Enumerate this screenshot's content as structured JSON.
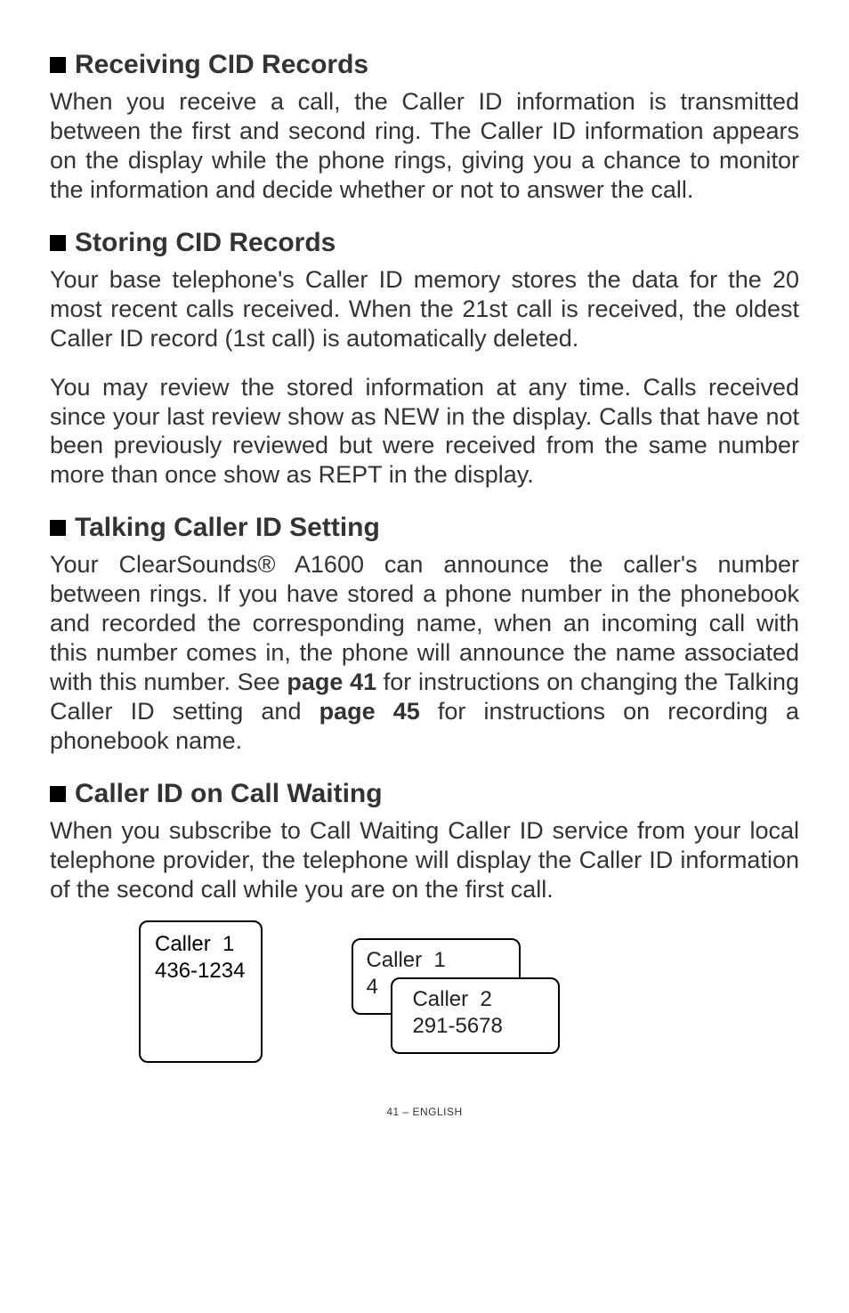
{
  "sections": [
    {
      "heading": "Receiving CID Records",
      "paragraphs": [
        "When you receive a call, the Caller ID information is transmitted between the first and second ring. The Caller ID information appears on the display while the phone rings, giving you a chance to monitor the information and decide whether or not to answer the call."
      ]
    },
    {
      "heading": "Storing CID Records",
      "paragraphs": [
        "Your base telephone's Caller ID memory stores the data for the 20 most recent calls received.  When the 21st call is received, the oldest Caller ID record (1st call) is automatically deleted.",
        "You may review the stored information at any time. Calls received since your last review show as NEW in the display. Calls that have not been previously reviewed but were received from the same number more than once show as REPT in the display."
      ]
    },
    {
      "heading": "Talking Caller ID Setting",
      "paragraphs_html": [
        "Your ClearSounds® A1600 can announce the caller's number between rings.  If you have stored a phone number in the phonebook and recorded the corresponding name, when an incoming call with this number comes in, the phone will announce the name associated with this number.  See <b>page 41</b> for instructions on changing the Talking Caller ID setting and <b>page 45</b> for instructions on recording a phonebook name."
      ]
    },
    {
      "heading": "Caller ID on Call Waiting",
      "paragraphs": [
        "When you subscribe to Call Waiting Caller ID service from your local telephone provider, the telephone will display the Caller ID information of the second call while you are on the first call."
      ]
    }
  ],
  "figure": {
    "left_box_line1": "Caller  1",
    "left_box_line2": "436-1234",
    "stack_behind_line1": "Caller  1",
    "stack_behind_line2": "4",
    "stack_front_line1": "Caller  2",
    "stack_front_line2": "291-5678"
  },
  "footer": "41 – ENGLISH"
}
